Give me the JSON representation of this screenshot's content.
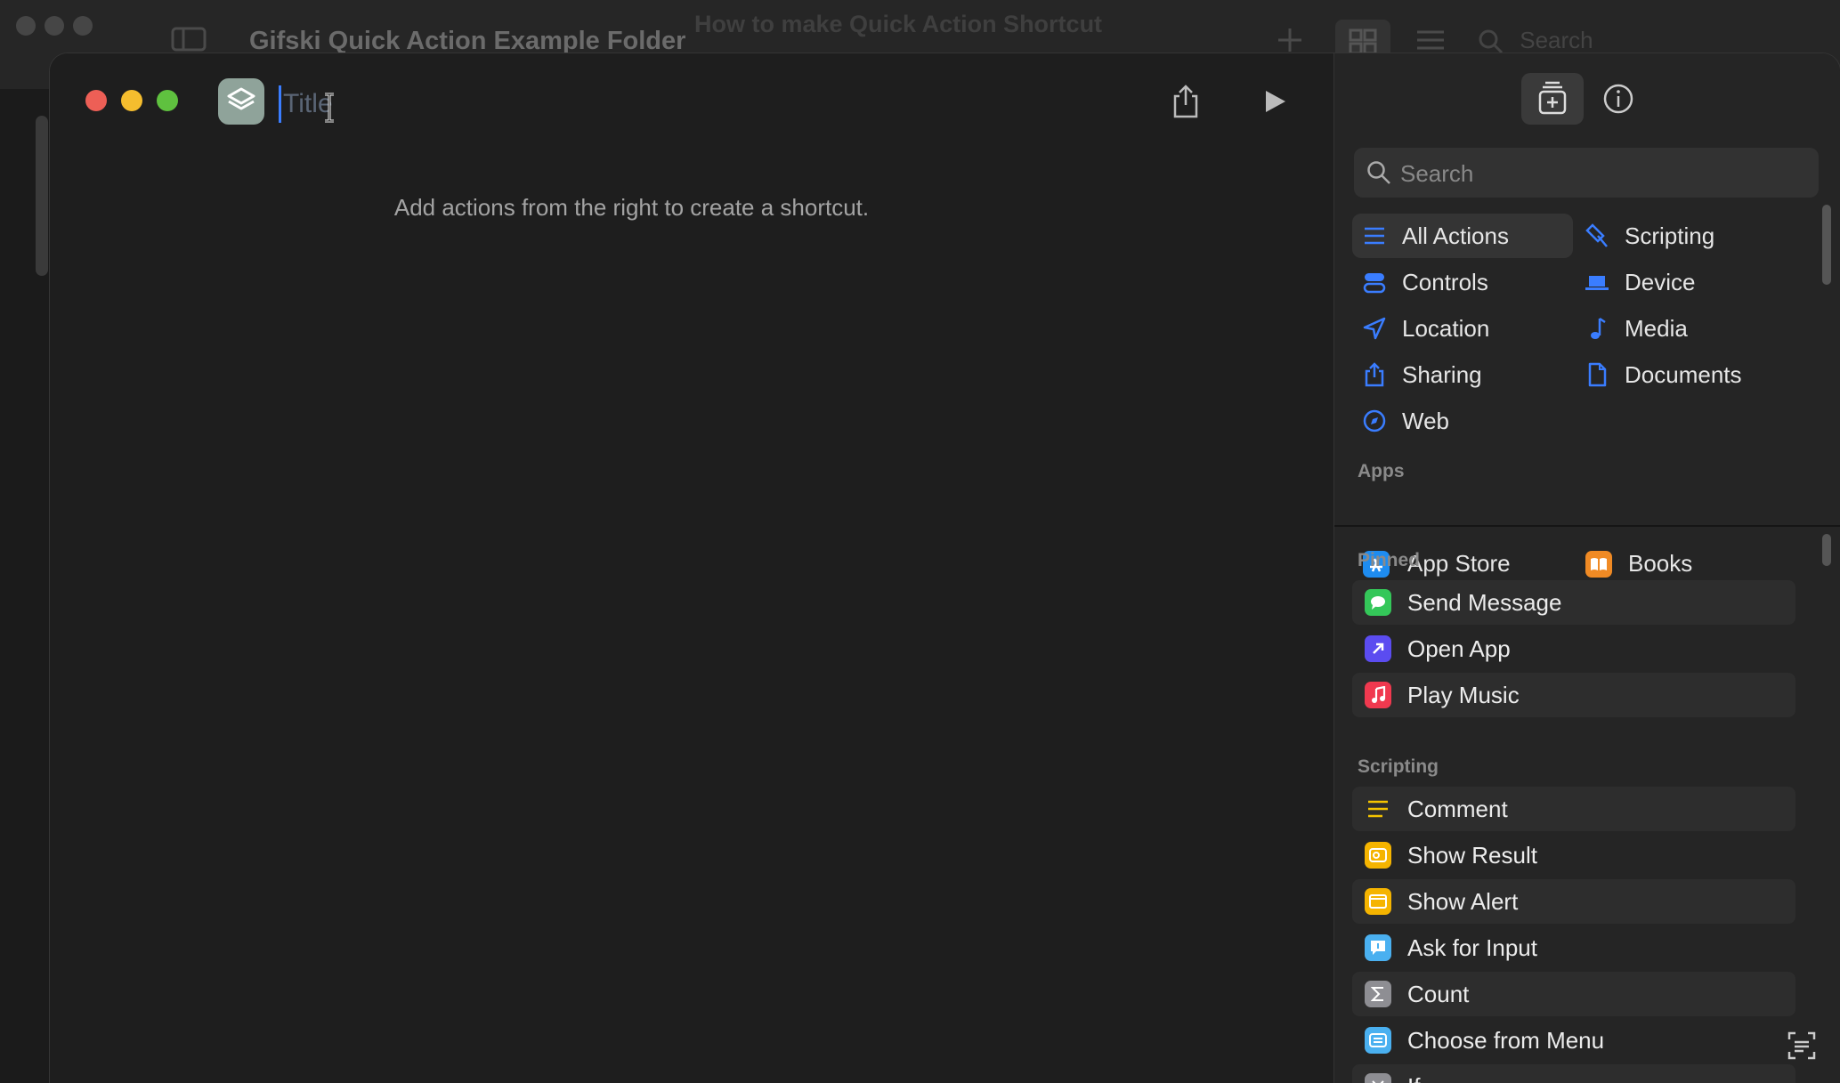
{
  "background": {
    "window_title": "Gifski Quick Action Example Folder",
    "doc_title": "How to make Quick Action Shortcut",
    "search_placeholder": "Search"
  },
  "editor": {
    "title_placeholder": "Title",
    "title_value": "",
    "hint": "Add actions from the right to create a shortcut."
  },
  "panel": {
    "search_placeholder": "Search",
    "categories": [
      {
        "label": "All Actions",
        "icon": "list-icon",
        "selected": true
      },
      {
        "label": "Scripting",
        "icon": "scripting-icon"
      },
      {
        "label": "Controls",
        "icon": "controls-icon"
      },
      {
        "label": "Device",
        "icon": "laptop-icon"
      },
      {
        "label": "Location",
        "icon": "location-arrow-icon"
      },
      {
        "label": "Media",
        "icon": "music-note-icon"
      },
      {
        "label": "Sharing",
        "icon": "share-icon"
      },
      {
        "label": "Documents",
        "icon": "document-icon"
      },
      {
        "label": "Web",
        "icon": "compass-icon"
      }
    ],
    "apps_label": "Apps",
    "apps": [
      {
        "label": "App Store",
        "icon": "app-store-icon",
        "color": "#1e8cf0"
      },
      {
        "label": "Books",
        "icon": "books-icon",
        "color": "#f08a24"
      }
    ],
    "pinned_label": "Pinned",
    "pinned": [
      {
        "label": "Send Message",
        "icon": "message-icon",
        "color": "#34c759"
      },
      {
        "label": "Open App",
        "icon": "open-app-icon",
        "color": "#5b4cf0"
      },
      {
        "label": "Play Music",
        "icon": "music-icon",
        "color": "#f0394f"
      }
    ],
    "scripting_label": "Scripting",
    "scripting": [
      {
        "label": "Comment",
        "icon": "comment-icon",
        "color": "#f5c400"
      },
      {
        "label": "Show Result",
        "icon": "show-result-icon",
        "color": "#f5b400"
      },
      {
        "label": "Show Alert",
        "icon": "alert-icon",
        "color": "#f5b400"
      },
      {
        "label": "Ask for Input",
        "icon": "ask-input-icon",
        "color": "#4ab0f0"
      },
      {
        "label": "Count",
        "icon": "sigma-icon",
        "color": "#8e8e93"
      },
      {
        "label": "Choose from Menu",
        "icon": "menu-icon",
        "color": "#4ab0f0"
      },
      {
        "label": "If",
        "icon": "if-icon",
        "color": "#8e8e93"
      }
    ]
  },
  "colors": {
    "accent": "#3a7dff",
    "close": "#ed5f56",
    "minimize": "#f5bd2e",
    "zoom": "#5fc13f"
  }
}
